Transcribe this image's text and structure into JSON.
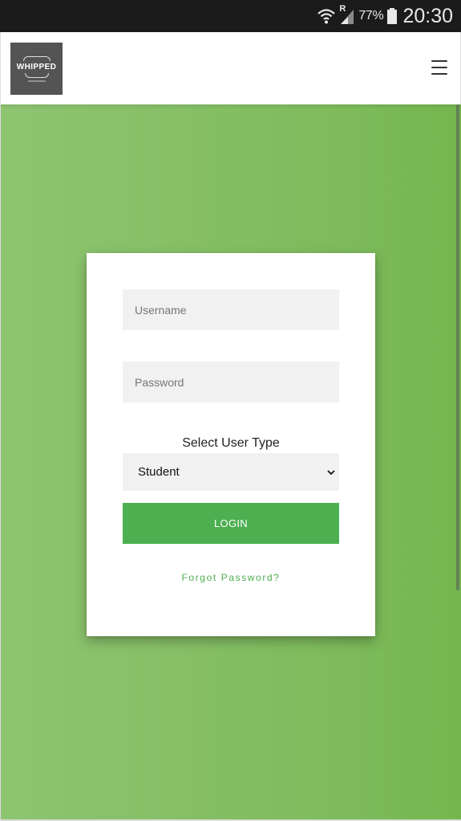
{
  "status_bar": {
    "roaming_label": "R",
    "battery_percent": "77%",
    "time": "20:30"
  },
  "header": {
    "logo_text": "WHIPPED",
    "menu_icon": "hamburger-menu-icon"
  },
  "login": {
    "username_placeholder": "Username",
    "password_placeholder": "Password",
    "select_label": "Select User Type",
    "user_type_selected": "Student",
    "login_button": "LOGIN",
    "forgot_password": "Forgot Password?"
  },
  "colors": {
    "accent_green": "#4caf50",
    "background_green": "#7dbb5b",
    "logo_bg": "#545454"
  }
}
